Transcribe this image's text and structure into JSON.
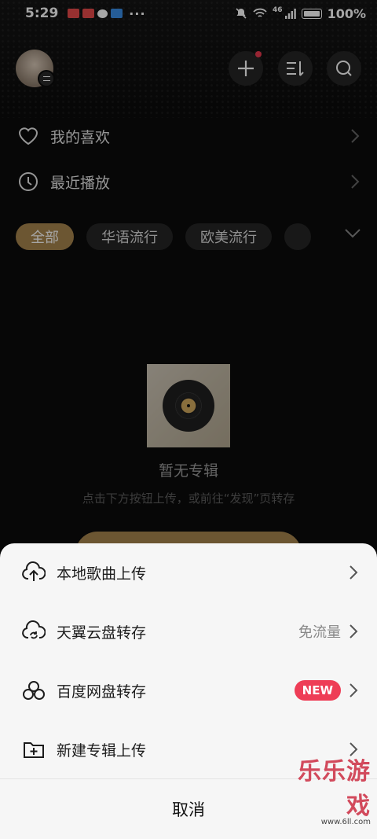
{
  "status_bar": {
    "time": "5:29",
    "signal": "46",
    "battery": "100%"
  },
  "header": {
    "add_icon": "plus-icon",
    "sort_icon": "sort-icon",
    "search_icon": "search-icon"
  },
  "rows": [
    {
      "label": "我的喜欢",
      "icon": "heart-icon"
    },
    {
      "label": "最近播放",
      "icon": "clock-icon"
    }
  ],
  "chips": {
    "items": [
      "全部",
      "华语流行",
      "欧美流行"
    ],
    "active": "全部"
  },
  "empty_state": {
    "title": "暂无专辑",
    "subtitle": "点击下方按钮上传，或前往“发现”页转存"
  },
  "sheet": {
    "items": [
      {
        "label": "本地歌曲上传",
        "icon": "upload-cloud-icon",
        "hint": "",
        "badge": ""
      },
      {
        "label": "天翼云盘转存",
        "icon": "cloud-sync-icon",
        "hint": "免流量",
        "badge": ""
      },
      {
        "label": "百度网盘转存",
        "icon": "baidu-cloud-icon",
        "hint": "",
        "badge": "NEW"
      },
      {
        "label": "新建专辑上传",
        "icon": "folder-add-icon",
        "hint": "",
        "badge": ""
      }
    ],
    "cancel": "取消"
  },
  "watermark": {
    "main": "乐乐游戏",
    "url": "www.6ll.com"
  },
  "colors": {
    "accent": "#a7844d",
    "badge": "#ee3d56",
    "background": "#0b0b0b",
    "sheet": "#f6f6f6"
  }
}
